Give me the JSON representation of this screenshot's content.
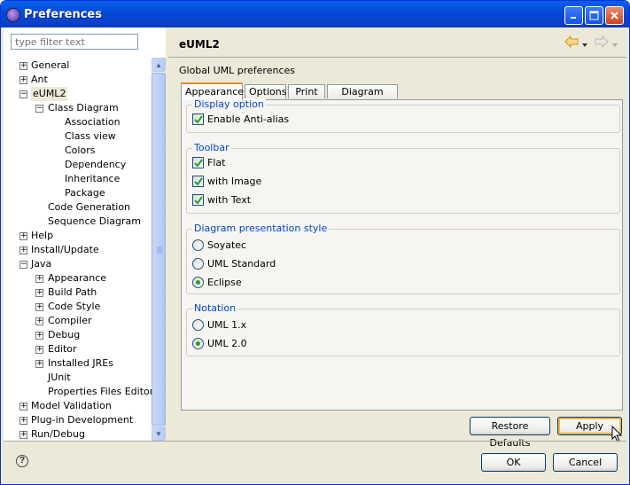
{
  "window": {
    "title": "Preferences"
  },
  "filter": {
    "placeholder": "type filter text"
  },
  "tree": [
    {
      "label": "General",
      "depth": 0,
      "expander": "plus"
    },
    {
      "label": "Ant",
      "depth": 0,
      "expander": "plus"
    },
    {
      "label": "eUML2",
      "depth": 0,
      "expander": "minus",
      "selected": true
    },
    {
      "label": "Class Diagram",
      "depth": 1,
      "expander": "minus"
    },
    {
      "label": "Association",
      "depth": 2,
      "expander": "none"
    },
    {
      "label": "Class view",
      "depth": 2,
      "expander": "none"
    },
    {
      "label": "Colors",
      "depth": 2,
      "expander": "none"
    },
    {
      "label": "Dependency",
      "depth": 2,
      "expander": "none"
    },
    {
      "label": "Inheritance",
      "depth": 2,
      "expander": "none"
    },
    {
      "label": "Package",
      "depth": 2,
      "expander": "none"
    },
    {
      "label": "Code Generation",
      "depth": 1,
      "expander": "none"
    },
    {
      "label": "Sequence Diagram",
      "depth": 1,
      "expander": "none"
    },
    {
      "label": "Help",
      "depth": 0,
      "expander": "plus"
    },
    {
      "label": "Install/Update",
      "depth": 0,
      "expander": "plus"
    },
    {
      "label": "Java",
      "depth": 0,
      "expander": "minus"
    },
    {
      "label": "Appearance",
      "depth": 1,
      "expander": "plus"
    },
    {
      "label": "Build Path",
      "depth": 1,
      "expander": "plus"
    },
    {
      "label": "Code Style",
      "depth": 1,
      "expander": "plus"
    },
    {
      "label": "Compiler",
      "depth": 1,
      "expander": "plus"
    },
    {
      "label": "Debug",
      "depth": 1,
      "expander": "plus"
    },
    {
      "label": "Editor",
      "depth": 1,
      "expander": "plus"
    },
    {
      "label": "Installed JREs",
      "depth": 1,
      "expander": "plus"
    },
    {
      "label": "JUnit",
      "depth": 1,
      "expander": "none"
    },
    {
      "label": "Properties Files Editor",
      "depth": 1,
      "expander": "none"
    },
    {
      "label": "Model Validation",
      "depth": 0,
      "expander": "plus"
    },
    {
      "label": "Plug-in Development",
      "depth": 0,
      "expander": "plus"
    },
    {
      "label": "Run/Debug",
      "depth": 0,
      "expander": "plus"
    }
  ],
  "page": {
    "title": "eUML2",
    "description": "Global UML preferences",
    "tabs": [
      "Appearance",
      "Options",
      "Print",
      "Diagram Board"
    ],
    "active_tab": "Appearance"
  },
  "groups": {
    "display": {
      "legend": "Display option",
      "items": [
        {
          "label": "Enable Anti-alias",
          "type": "checkbox",
          "checked": true
        }
      ]
    },
    "toolbar": {
      "legend": "Toolbar",
      "items": [
        {
          "label": "Flat",
          "type": "checkbox",
          "checked": true
        },
        {
          "label": "with Image",
          "type": "checkbox",
          "checked": true
        },
        {
          "label": "with Text",
          "type": "checkbox",
          "checked": true
        }
      ]
    },
    "presentation": {
      "legend": "Diagram presentation style",
      "items": [
        {
          "label": "Soyatec",
          "type": "radio",
          "checked": false
        },
        {
          "label": "UML Standard",
          "type": "radio",
          "checked": false
        },
        {
          "label": "Eclipse",
          "type": "radio",
          "checked": true
        }
      ]
    },
    "notation": {
      "legend": "Notation",
      "items": [
        {
          "label": "UML 1.x",
          "type": "radio",
          "checked": false
        },
        {
          "label": "UML 2.0",
          "type": "radio",
          "checked": true
        }
      ]
    }
  },
  "buttons": {
    "restore_defaults": "Restore Defaults",
    "apply": "Apply",
    "ok": "OK",
    "cancel": "Cancel"
  },
  "icons": {
    "help": "help-icon",
    "back": "back-arrow-icon",
    "forward": "forward-arrow-icon"
  },
  "colors": {
    "titlebar": "#0349d6",
    "legend_text": "#0046d5",
    "active_tab_accent": "#e68b2c",
    "check": "#21a121"
  }
}
